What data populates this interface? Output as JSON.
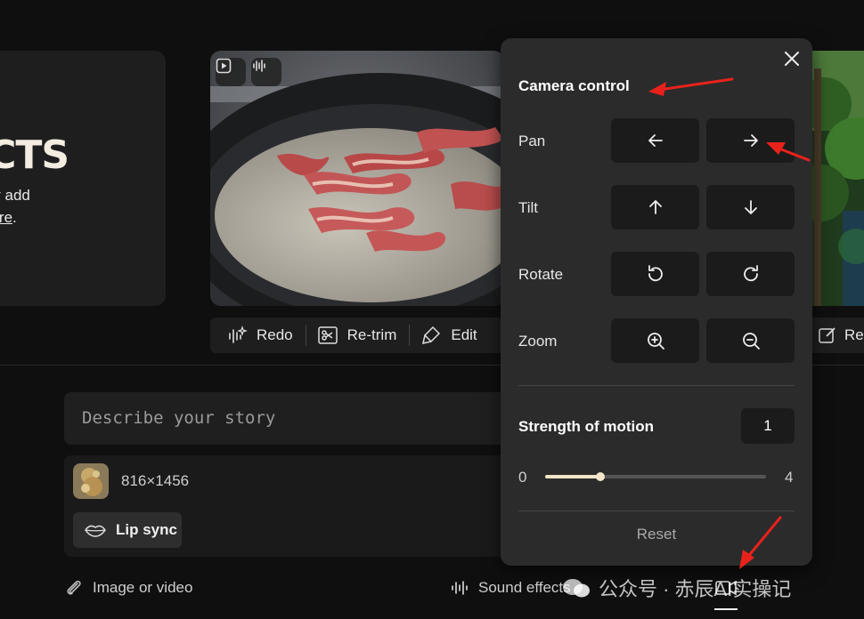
{
  "promo": {
    "title": "FECTS",
    "line1": "sly add",
    "line2_link": "here",
    "line2_suffix": "."
  },
  "toolbar": {
    "redo": "Redo",
    "retrim": "Re-trim",
    "edit": "Edit"
  },
  "right_toolbar": {
    "label": "Re"
  },
  "prompt": {
    "placeholder": "Describe your story"
  },
  "attachment": {
    "dimensions": "816×1456",
    "lip_sync": "Lip sync"
  },
  "bottom_bar": {
    "image_or_video": "Image or video",
    "sound_effects": "Sound effects"
  },
  "camera_panel": {
    "title": "Camera control",
    "rows": {
      "pan": "Pan",
      "tilt": "Tilt",
      "rotate": "Rotate",
      "zoom": "Zoom"
    },
    "strength": {
      "label": "Strength of motion",
      "value": "1",
      "min": "0",
      "max": "4",
      "fraction": 0.25
    },
    "reset": "Reset"
  },
  "watermark": {
    "text": "公众号 · 赤辰AI实操记"
  },
  "colors": {
    "background": "#0f0f0f",
    "panel": "#2b2b2b",
    "annotation_arrow": "#e8221b",
    "slider_accent": "#f3e5c8"
  }
}
